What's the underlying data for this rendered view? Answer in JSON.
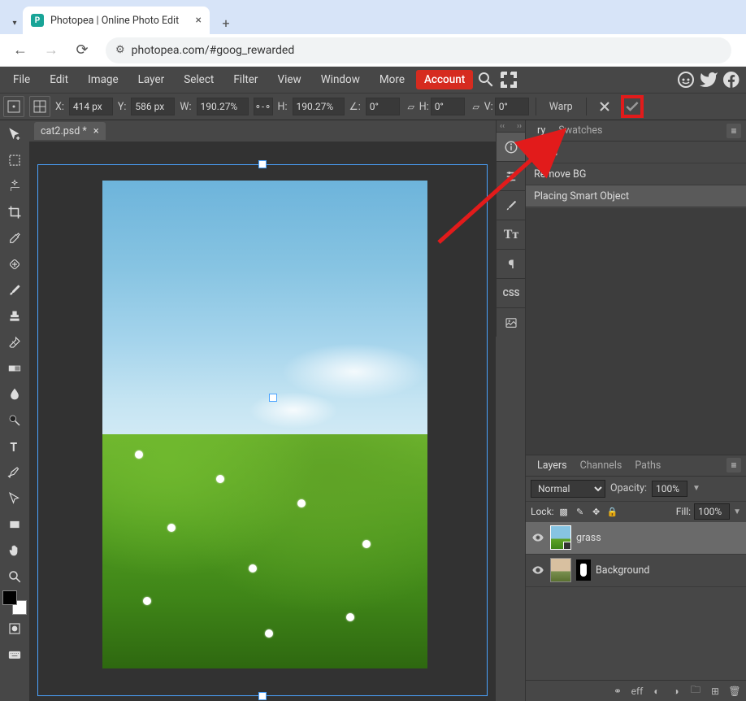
{
  "browser": {
    "tab_title": "Photopea | Online Photo Edit",
    "url": "photopea.com/#goog_rewarded"
  },
  "menu": {
    "items": [
      "File",
      "Edit",
      "Image",
      "Layer",
      "Select",
      "Filter",
      "View",
      "Window",
      "More"
    ],
    "account": "Account"
  },
  "options_bar": {
    "x_label": "X:",
    "x_value": "414 px",
    "y_label": "Y:",
    "y_value": "586 px",
    "w_label": "W:",
    "w_value": "190.27%",
    "h_label": "H:",
    "h_value": "190.27%",
    "angle_icon": "∠:",
    "angle_value": "0°",
    "skew_h_label": "H:",
    "skew_h_value": "0°",
    "skew_v_label": "V:",
    "skew_v_value": "0°",
    "warp_label": "Warp"
  },
  "document": {
    "tab_name": "cat2.psd *"
  },
  "side_icons": {
    "css_label": "CSS"
  },
  "right_panels": {
    "top_tabs": {
      "history": "ry",
      "swatches": "Swatches"
    },
    "history_items": [
      "Open",
      "Remove BG",
      "Placing Smart Object"
    ],
    "layers_tabs": {
      "layers": "Layers",
      "channels": "Channels",
      "paths": "Paths"
    },
    "blend_mode": "Normal",
    "opacity_label": "Opacity:",
    "opacity_value": "100%",
    "lock_label": "Lock:",
    "fill_label": "Fill:",
    "fill_value": "100%",
    "layer_items": [
      {
        "name": "grass"
      },
      {
        "name": "Background"
      }
    ],
    "footer_eff": "eff"
  }
}
